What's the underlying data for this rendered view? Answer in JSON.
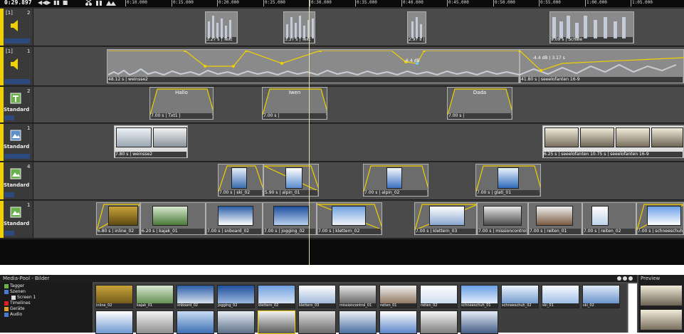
{
  "transport": {
    "time": "0:29.897",
    "buttons": [
      "◀◀",
      "▶",
      "▮▮",
      "■"
    ],
    "tool_icons": [
      "scissors-icon",
      "split-icon",
      "group-icon"
    ]
  },
  "ruler": {
    "ticks": [
      "0:10.000",
      "0:15.000",
      "0:20.000",
      "0:25.000",
      "0:30.000",
      "0:35.000",
      "0:40.000",
      "0:45.000",
      "0:50.000",
      "0:55.000",
      "1:00.000",
      "1:05.000"
    ]
  },
  "tracks": [
    {
      "index": "[1]",
      "number": "2",
      "type": "audio",
      "label": "",
      "clips": [
        {
          "label": "3.27 s | Text"
        },
        {
          "label": "3.37 s | Text"
        },
        {
          "label": "2.97 s | Text"
        },
        {
          "label": "9.09 s | Schale"
        }
      ]
    },
    {
      "index": "[1]",
      "number": "1",
      "type": "audio",
      "label": "",
      "clips": [
        {
          "label": "48.12 s | weinsse2"
        },
        {
          "label": "41.80 s | seeelofanten 16-9"
        }
      ],
      "gain_labels": [
        "-6.4 dB",
        "-4.4 dB | 3.17 s"
      ]
    },
    {
      "index": "",
      "number": "2",
      "type": "title",
      "label": "Standard",
      "clips": [
        {
          "title": "Hallo",
          "label": "7.00 s | Txt1 |"
        },
        {
          "title": "Iwen",
          "label": "7.00 s |"
        },
        {
          "title": "Dada",
          "label": "7.00 s |"
        }
      ]
    },
    {
      "index": "",
      "number": "1",
      "type": "video",
      "label": "Standard",
      "clips": [
        {
          "label": "7.80 s | weinsse2"
        },
        {
          "label": "6.25 s | seeelofanten 10.75 s | seeelofanten 16-9"
        }
      ]
    },
    {
      "index": "",
      "number": "4",
      "type": "image",
      "label": "Standard",
      "clips": [
        {
          "label": "7.00 s | ski_02"
        },
        {
          "label": "5.90 s | alpin_01"
        },
        {
          "label": "7.00 s | alpin_02"
        },
        {
          "label": "7.00 s | glati_01"
        }
      ]
    },
    {
      "index": "",
      "number": "1",
      "type": "image",
      "label": "Standard",
      "clips": [
        {
          "label": "6.80 s | inline_02"
        },
        {
          "label": "6.20 s | kajak_01"
        },
        {
          "label": "7.00 s | snboard_02"
        },
        {
          "label": "7.00 s | jogging_02"
        },
        {
          "label": "7.00 s | klettern_02"
        },
        {
          "label": "7.00 s | klettern_03"
        },
        {
          "label": "7.00 s | missioncontrol_01"
        },
        {
          "label": "7.00 s | reiten_01"
        },
        {
          "label": "7.00 s | reiten_02"
        },
        {
          "label": "7.00 s | schneeschuh_"
        }
      ]
    }
  ],
  "pool": {
    "title": "Media-Pool - Bilder",
    "tree": [
      "Tagger",
      "Szenen",
      "Screen 1",
      "Timelines",
      "Geräte",
      "Audio"
    ],
    "row1": [
      "inline_02",
      "kajak_01",
      "snboard_02",
      "jogging_02",
      "klettern_02",
      "klettern_03",
      "missioncontrol_01",
      "reiten_01",
      "reiten_02",
      "schneeschuh_01",
      "schneeschuh_02",
      "ski_01",
      "ski_02"
    ],
    "row2": [
      "",
      "",
      "",
      "",
      "",
      "",
      "",
      "",
      "",
      ""
    ]
  },
  "preview": {
    "title": "Preview"
  }
}
